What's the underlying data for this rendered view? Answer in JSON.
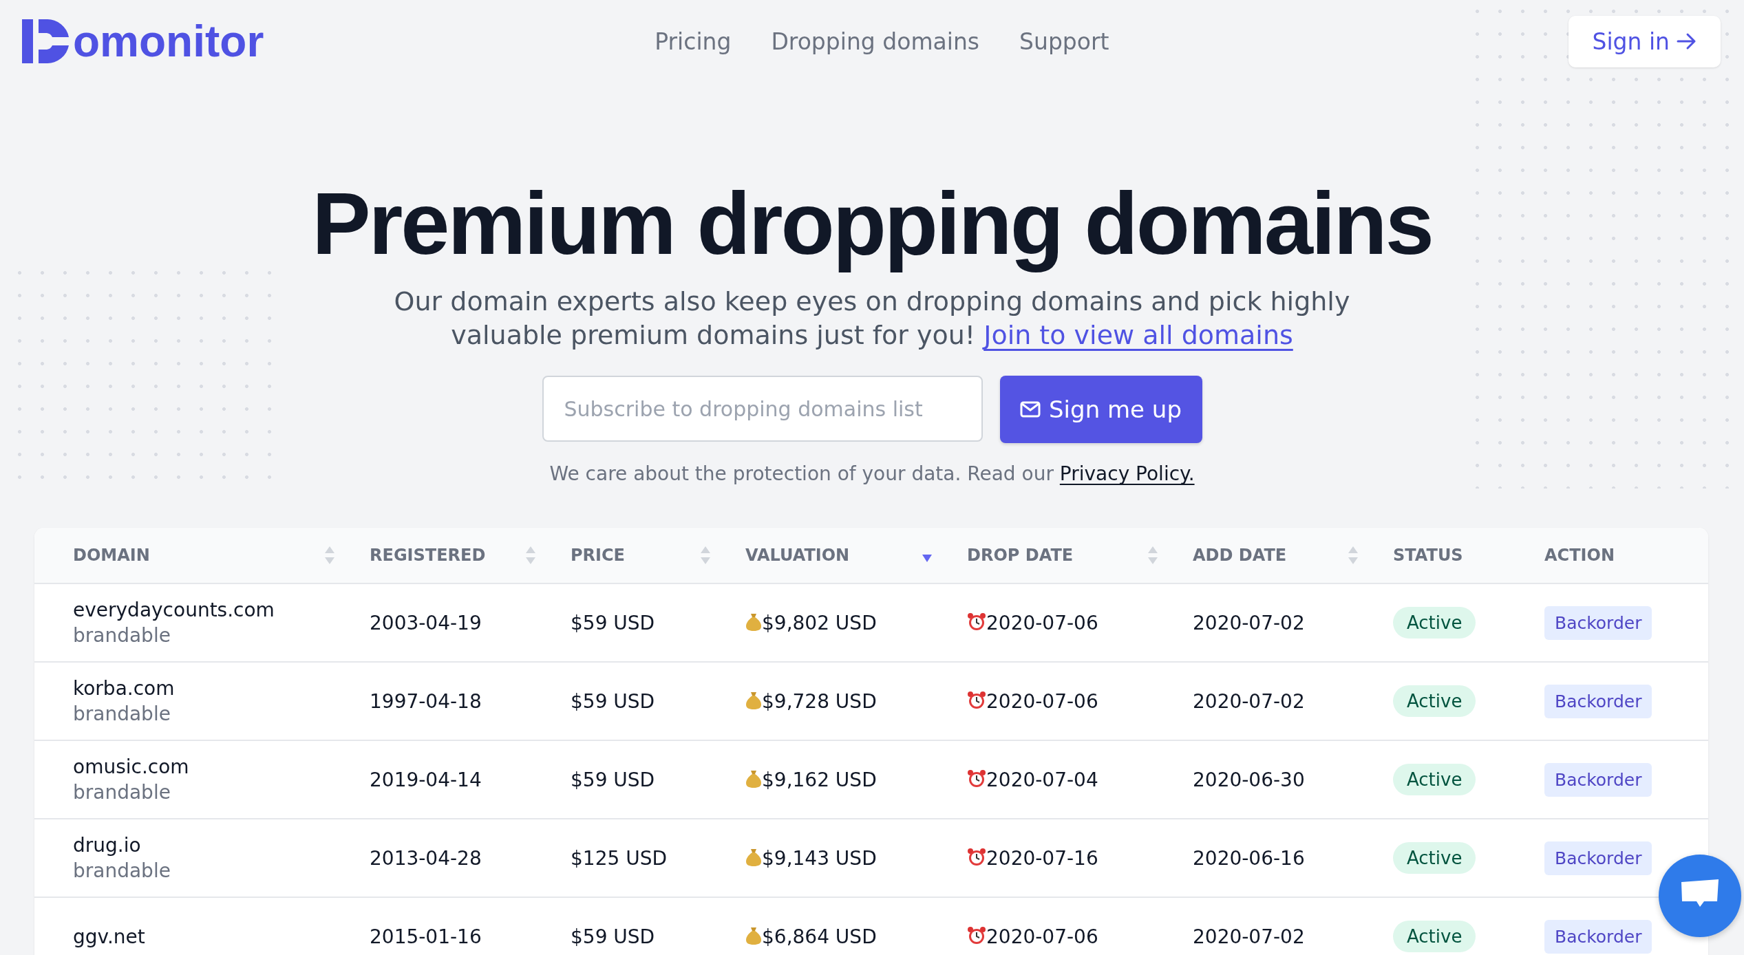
{
  "header": {
    "logo": "omonitor",
    "nav": [
      "Pricing",
      "Dropping domains",
      "Support"
    ],
    "sign_in": "Sign in"
  },
  "hero": {
    "title": "Premium dropping domains",
    "subtitle": "Our domain experts also keep eyes on dropping domains and pick highly valuable premium domains just for you!",
    "link": "Join to view all domains",
    "input": {
      "placeholder": "Subscribe to dropping domains list"
    },
    "button": "Sign me up",
    "note": "We care about the protection of your data. Read our",
    "note_link": "Privacy Policy."
  },
  "table": {
    "columns": [
      {
        "label": "DOMAIN",
        "kind": "sortable",
        "sorted": false
      },
      {
        "label": "REGISTERED",
        "kind": "sortable",
        "sorted": false
      },
      {
        "label": "PRICE",
        "kind": "sortable",
        "sorted": false
      },
      {
        "label": "VALUATION",
        "kind": "sortable",
        "sorted": true
      },
      {
        "label": "DROP DATE",
        "kind": "sortable",
        "sorted": false
      },
      {
        "label": "ADD DATE",
        "kind": "sortable",
        "sorted": false
      },
      {
        "label": "STATUS",
        "kind": "plain"
      },
      {
        "label": "ACTION",
        "kind": "plain"
      }
    ],
    "rows": [
      {
        "domain": "everydaycounts.com",
        "tag": "brandable",
        "registered": "2003-04-19",
        "price": "$59 USD",
        "valuation": "$9,802 USD",
        "drop_date": "2020-07-06",
        "add_date": "2020-07-02",
        "status": "Active",
        "action": "Backorder"
      },
      {
        "domain": "korba.com",
        "tag": "brandable",
        "registered": "1997-04-18",
        "price": "$59 USD",
        "valuation": "$9,728 USD",
        "drop_date": "2020-07-06",
        "add_date": "2020-07-02",
        "status": "Active",
        "action": "Backorder"
      },
      {
        "domain": "omusic.com",
        "tag": "brandable",
        "registered": "2019-04-14",
        "price": "$59 USD",
        "valuation": "$9,162 USD",
        "drop_date": "2020-07-04",
        "add_date": "2020-06-30",
        "status": "Active",
        "action": "Backorder"
      },
      {
        "domain": "drug.io",
        "tag": "brandable",
        "registered": "2013-04-28",
        "price": "$125 USD",
        "valuation": "$9,143 USD",
        "drop_date": "2020-07-16",
        "add_date": "2020-06-16",
        "status": "Active",
        "action": "Backorder"
      },
      {
        "domain": "ggv.net",
        "registered": "2015-01-16",
        "price": "$59 USD",
        "valuation": "$6,864 USD",
        "drop_date": "2020-07-06",
        "add_date": "2020-07-02",
        "status": "Active",
        "action": "Backorder"
      }
    ]
  }
}
